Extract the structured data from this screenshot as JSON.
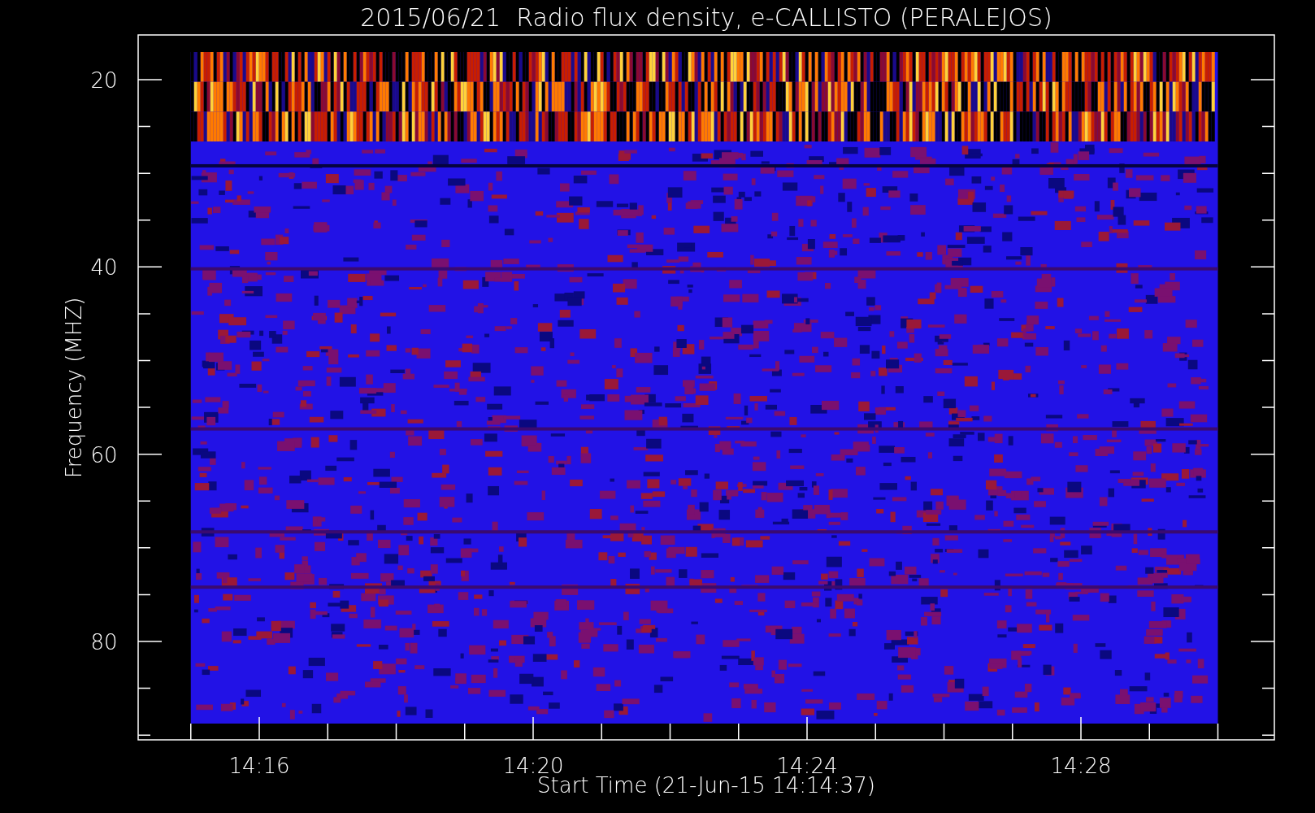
{
  "plot": {
    "title": "2015/06/21  Radio flux density, e-CALLISTO (PERALEJOS)",
    "xlabel": "Start Time (21-Jun-15 14:14:37)",
    "ylabel": "Frequency (MHZ)",
    "xticks": [
      "14:16",
      "14:20",
      "14:24",
      "14:28"
    ],
    "yticks": [
      "20",
      "40",
      "60",
      "80"
    ]
  }
}
